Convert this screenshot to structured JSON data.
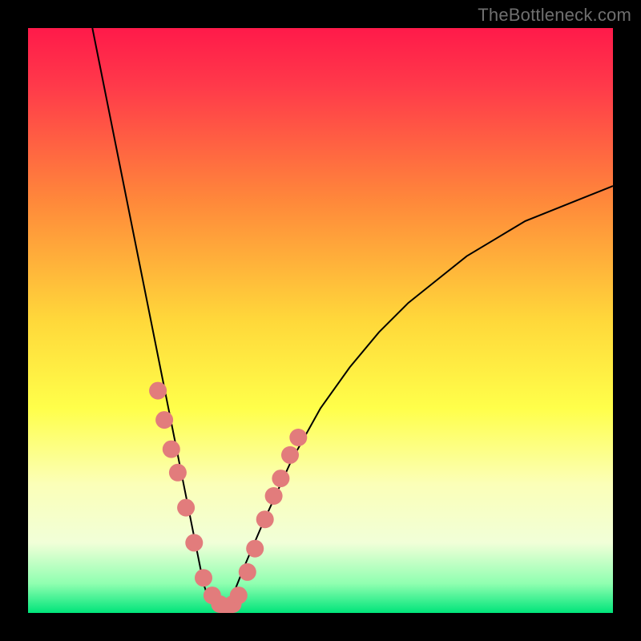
{
  "watermark": "TheBottleneck.com",
  "colors": {
    "frame": "#000000",
    "curve": "#000000",
    "dots": "#e27c7c",
    "gradient_stops": [
      {
        "pos": 0.0,
        "color": "#ff1a4a"
      },
      {
        "pos": 0.1,
        "color": "#ff3a4a"
      },
      {
        "pos": 0.3,
        "color": "#ff8a3a"
      },
      {
        "pos": 0.5,
        "color": "#ffd83a"
      },
      {
        "pos": 0.65,
        "color": "#ffff4a"
      },
      {
        "pos": 0.78,
        "color": "#fbffb8"
      },
      {
        "pos": 0.88,
        "color": "#f1ffd8"
      },
      {
        "pos": 0.95,
        "color": "#8fffb0"
      },
      {
        "pos": 1.0,
        "color": "#00e47a"
      }
    ]
  },
  "chart_data": {
    "type": "line",
    "title": "",
    "xlabel": "",
    "ylabel": "",
    "xlim": [
      0,
      100
    ],
    "ylim": [
      0,
      100
    ],
    "series": [
      {
        "name": "curve",
        "x": [
          11,
          13,
          15,
          17,
          19,
          21,
          23,
          25,
          27,
          29,
          30,
          31,
          32,
          33,
          34,
          35,
          37,
          40,
          45,
          50,
          55,
          60,
          65,
          70,
          75,
          80,
          85,
          90,
          95,
          100
        ],
        "y": [
          100,
          90,
          80,
          70,
          60,
          50,
          40,
          30,
          20,
          10,
          5,
          2,
          1,
          0.5,
          1,
          3,
          8,
          15,
          26,
          35,
          42,
          48,
          53,
          57,
          61,
          64,
          67,
          69,
          71,
          73
        ]
      }
    ],
    "dots": {
      "name": "sample-points",
      "x": [
        22.2,
        23.3,
        24.5,
        25.6,
        27.0,
        28.4,
        30.0,
        31.5,
        32.8,
        34.0,
        35.0,
        36.0,
        37.5,
        38.8,
        40.5,
        42.0,
        43.2,
        44.8,
        46.2
      ],
      "y": [
        38,
        33,
        28,
        24,
        18,
        12,
        6,
        3,
        1.5,
        1,
        1.5,
        3,
        7,
        11,
        16,
        20,
        23,
        27,
        30
      ]
    }
  }
}
